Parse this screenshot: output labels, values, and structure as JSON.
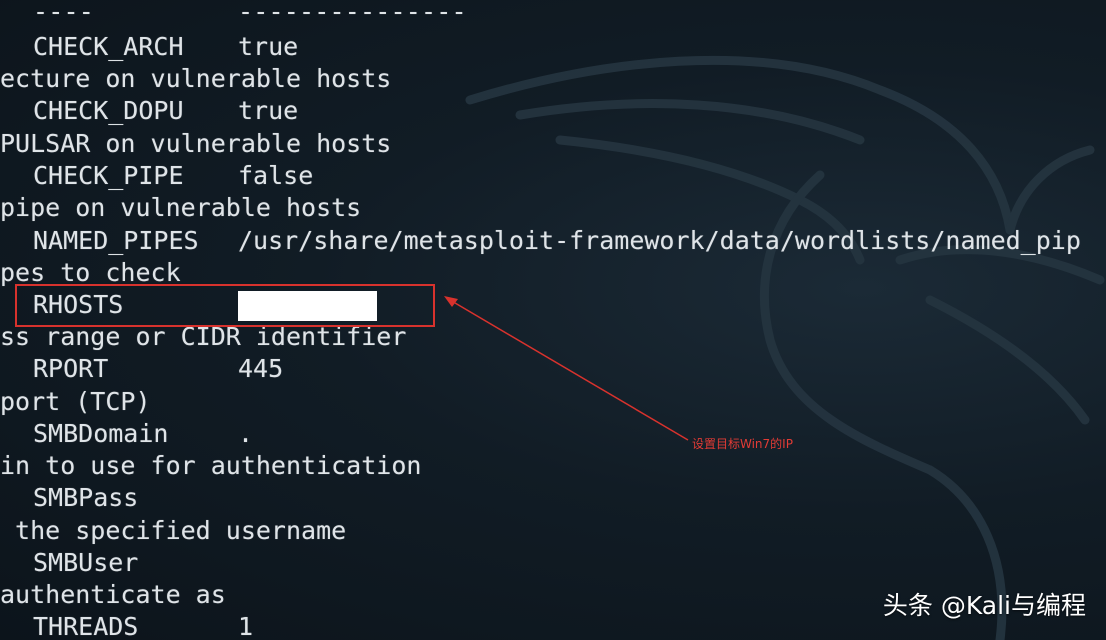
{
  "terminal": {
    "header_dash_name": "----",
    "header_dash_value": "---------------",
    "options": [
      {
        "name": "CHECK_ARCH",
        "value": "true",
        "description": "ecture on vulnerable hosts"
      },
      {
        "name": "CHECK_DOPU",
        "value": "true",
        "description": "PULSAR on vulnerable hosts"
      },
      {
        "name": "CHECK_PIPE",
        "value": "false",
        "description": "pipe on vulnerable hosts"
      },
      {
        "name": "NAMED_PIPES",
        "value": "/usr/share/metasploit-framework/data/wordlists/named_pip",
        "description": "pes to check"
      },
      {
        "name": "RHOSTS",
        "value": "",
        "description": "ss range or CIDR identifier"
      },
      {
        "name": "RPORT",
        "value": "445",
        "description": "port (TCP)"
      },
      {
        "name": "SMBDomain",
        "value": ".",
        "description": "in to use for authentication"
      },
      {
        "name": "SMBPass",
        "value": "",
        "description": " the specified username"
      },
      {
        "name": "SMBUser",
        "value": "",
        "description": "authenticate as"
      },
      {
        "name": "THREADS",
        "value": "1",
        "description": ""
      }
    ]
  },
  "annotation": {
    "text": "设置目标Win7的IP",
    "color": "#d8322d"
  },
  "watermark": {
    "text": "头条 @Kali与编程"
  },
  "colors": {
    "background": "#111c25",
    "terminal_text": "#dfe4e8",
    "annotation_red": "#d8322d"
  }
}
